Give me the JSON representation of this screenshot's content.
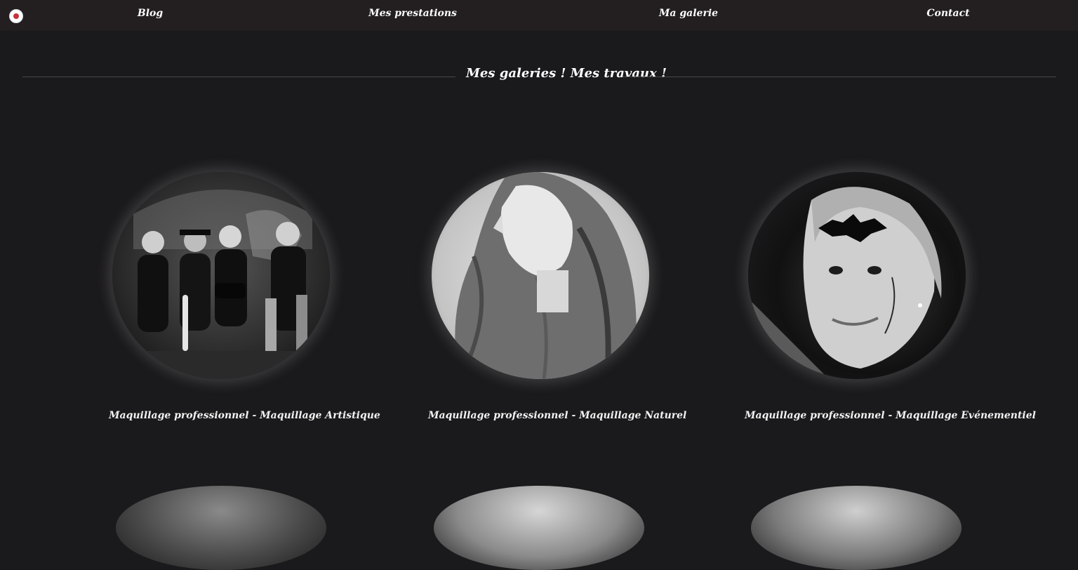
{
  "nav": {
    "logo_icon": "brand-logo-icon",
    "items": [
      "Blog",
      "Mes prestations",
      "Ma galerie",
      "Contact"
    ]
  },
  "gallery": {
    "title": "Mes galeries ! Mes travaux !",
    "cards": [
      {
        "title": "Maquillage professionnel - Maquillage Artistique"
      },
      {
        "title": "Maquillage professionnel - Maquillage Naturel"
      },
      {
        "title": "Maquillage professionnel - Maquillage Evénementiel"
      }
    ]
  },
  "colors": {
    "background": "#1a191b",
    "navbar": "#231f20",
    "text": "#ffffff",
    "logo_accent": "#c7323a"
  }
}
